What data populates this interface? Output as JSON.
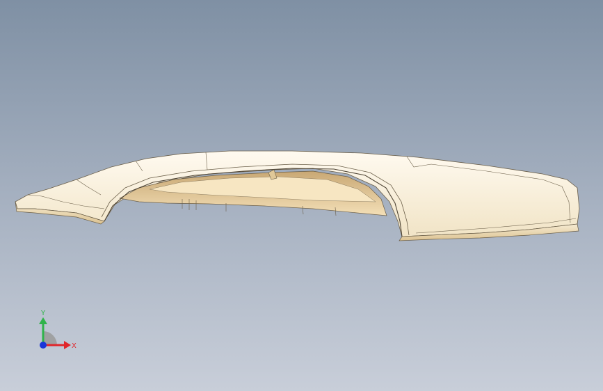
{
  "viewport": {
    "background_top": "#7f90a4",
    "background_bottom": "#c8ced9"
  },
  "model": {
    "part_color": "#fbf4e6",
    "shadow_color": "#d9c08f",
    "edge_color": "#5a5040",
    "cavity_color": "#e8cfa0"
  },
  "triad": {
    "x_label": "X",
    "y_label": "Y",
    "x_color": "#e0262b",
    "y_color": "#2fb34a",
    "z_color": "#1a36d9"
  }
}
